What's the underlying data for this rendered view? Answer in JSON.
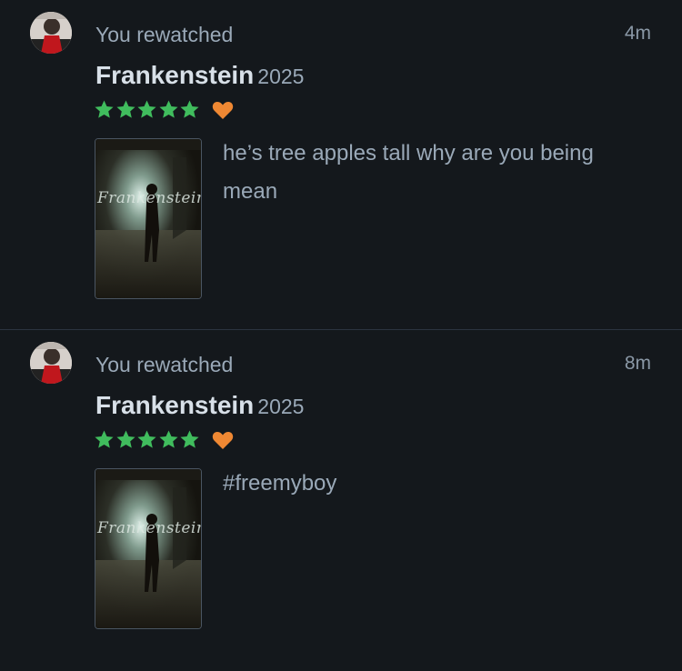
{
  "entries": [
    {
      "action": "You rewatched",
      "time": "4m",
      "film_title": "Frankenstein",
      "film_year": "2025",
      "stars": 5,
      "liked": true,
      "poster_title": "Frankenstein",
      "review": "he’s tree apples tall why are you being mean"
    },
    {
      "action": "You rewatched",
      "time": "8m",
      "film_title": "Frankenstein",
      "film_year": "2025",
      "stars": 5,
      "liked": true,
      "poster_title": "Frankenstein",
      "review": "#freemyboy"
    }
  ],
  "colors": {
    "background": "#14181c",
    "star": "#40bc5d",
    "heart": "#ef8833",
    "divider": "#2c3440"
  },
  "icons": {
    "star": "star-icon",
    "heart": "heart-icon",
    "avatar": "user-avatar"
  }
}
